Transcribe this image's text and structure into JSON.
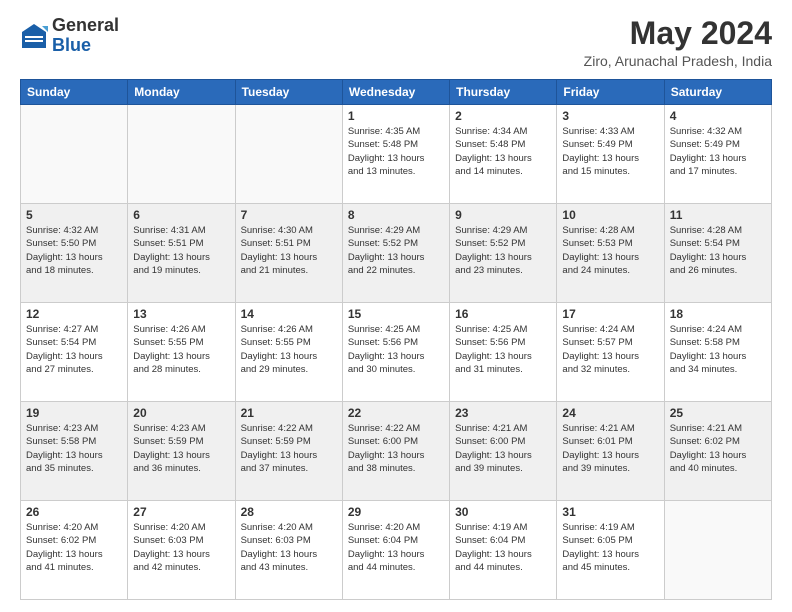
{
  "logo": {
    "general": "General",
    "blue": "Blue"
  },
  "title": "May 2024",
  "location": "Ziro, Arunachal Pradesh, India",
  "weekdays": [
    "Sunday",
    "Monday",
    "Tuesday",
    "Wednesday",
    "Thursday",
    "Friday",
    "Saturday"
  ],
  "weeks": [
    [
      {
        "day": "",
        "info": ""
      },
      {
        "day": "",
        "info": ""
      },
      {
        "day": "",
        "info": ""
      },
      {
        "day": "1",
        "info": "Sunrise: 4:35 AM\nSunset: 5:48 PM\nDaylight: 13 hours\nand 13 minutes."
      },
      {
        "day": "2",
        "info": "Sunrise: 4:34 AM\nSunset: 5:48 PM\nDaylight: 13 hours\nand 14 minutes."
      },
      {
        "day": "3",
        "info": "Sunrise: 4:33 AM\nSunset: 5:49 PM\nDaylight: 13 hours\nand 15 minutes."
      },
      {
        "day": "4",
        "info": "Sunrise: 4:32 AM\nSunset: 5:49 PM\nDaylight: 13 hours\nand 17 minutes."
      }
    ],
    [
      {
        "day": "5",
        "info": "Sunrise: 4:32 AM\nSunset: 5:50 PM\nDaylight: 13 hours\nand 18 minutes."
      },
      {
        "day": "6",
        "info": "Sunrise: 4:31 AM\nSunset: 5:51 PM\nDaylight: 13 hours\nand 19 minutes."
      },
      {
        "day": "7",
        "info": "Sunrise: 4:30 AM\nSunset: 5:51 PM\nDaylight: 13 hours\nand 21 minutes."
      },
      {
        "day": "8",
        "info": "Sunrise: 4:29 AM\nSunset: 5:52 PM\nDaylight: 13 hours\nand 22 minutes."
      },
      {
        "day": "9",
        "info": "Sunrise: 4:29 AM\nSunset: 5:52 PM\nDaylight: 13 hours\nand 23 minutes."
      },
      {
        "day": "10",
        "info": "Sunrise: 4:28 AM\nSunset: 5:53 PM\nDaylight: 13 hours\nand 24 minutes."
      },
      {
        "day": "11",
        "info": "Sunrise: 4:28 AM\nSunset: 5:54 PM\nDaylight: 13 hours\nand 26 minutes."
      }
    ],
    [
      {
        "day": "12",
        "info": "Sunrise: 4:27 AM\nSunset: 5:54 PM\nDaylight: 13 hours\nand 27 minutes."
      },
      {
        "day": "13",
        "info": "Sunrise: 4:26 AM\nSunset: 5:55 PM\nDaylight: 13 hours\nand 28 minutes."
      },
      {
        "day": "14",
        "info": "Sunrise: 4:26 AM\nSunset: 5:55 PM\nDaylight: 13 hours\nand 29 minutes."
      },
      {
        "day": "15",
        "info": "Sunrise: 4:25 AM\nSunset: 5:56 PM\nDaylight: 13 hours\nand 30 minutes."
      },
      {
        "day": "16",
        "info": "Sunrise: 4:25 AM\nSunset: 5:56 PM\nDaylight: 13 hours\nand 31 minutes."
      },
      {
        "day": "17",
        "info": "Sunrise: 4:24 AM\nSunset: 5:57 PM\nDaylight: 13 hours\nand 32 minutes."
      },
      {
        "day": "18",
        "info": "Sunrise: 4:24 AM\nSunset: 5:58 PM\nDaylight: 13 hours\nand 34 minutes."
      }
    ],
    [
      {
        "day": "19",
        "info": "Sunrise: 4:23 AM\nSunset: 5:58 PM\nDaylight: 13 hours\nand 35 minutes."
      },
      {
        "day": "20",
        "info": "Sunrise: 4:23 AM\nSunset: 5:59 PM\nDaylight: 13 hours\nand 36 minutes."
      },
      {
        "day": "21",
        "info": "Sunrise: 4:22 AM\nSunset: 5:59 PM\nDaylight: 13 hours\nand 37 minutes."
      },
      {
        "day": "22",
        "info": "Sunrise: 4:22 AM\nSunset: 6:00 PM\nDaylight: 13 hours\nand 38 minutes."
      },
      {
        "day": "23",
        "info": "Sunrise: 4:21 AM\nSunset: 6:00 PM\nDaylight: 13 hours\nand 39 minutes."
      },
      {
        "day": "24",
        "info": "Sunrise: 4:21 AM\nSunset: 6:01 PM\nDaylight: 13 hours\nand 39 minutes."
      },
      {
        "day": "25",
        "info": "Sunrise: 4:21 AM\nSunset: 6:02 PM\nDaylight: 13 hours\nand 40 minutes."
      }
    ],
    [
      {
        "day": "26",
        "info": "Sunrise: 4:20 AM\nSunset: 6:02 PM\nDaylight: 13 hours\nand 41 minutes."
      },
      {
        "day": "27",
        "info": "Sunrise: 4:20 AM\nSunset: 6:03 PM\nDaylight: 13 hours\nand 42 minutes."
      },
      {
        "day": "28",
        "info": "Sunrise: 4:20 AM\nSunset: 6:03 PM\nDaylight: 13 hours\nand 43 minutes."
      },
      {
        "day": "29",
        "info": "Sunrise: 4:20 AM\nSunset: 6:04 PM\nDaylight: 13 hours\nand 44 minutes."
      },
      {
        "day": "30",
        "info": "Sunrise: 4:19 AM\nSunset: 6:04 PM\nDaylight: 13 hours\nand 44 minutes."
      },
      {
        "day": "31",
        "info": "Sunrise: 4:19 AM\nSunset: 6:05 PM\nDaylight: 13 hours\nand 45 minutes."
      },
      {
        "day": "",
        "info": ""
      }
    ]
  ]
}
